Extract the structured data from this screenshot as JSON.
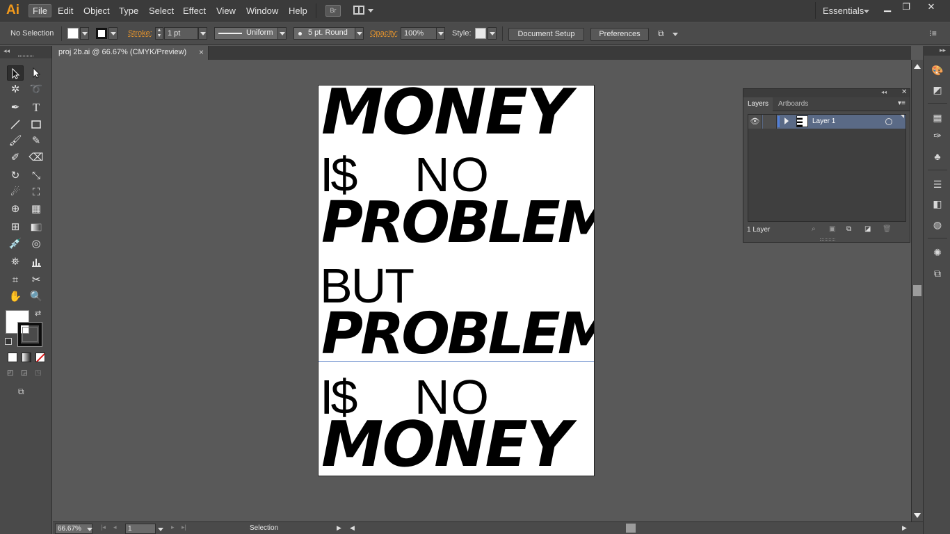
{
  "app": {
    "logo": "Ai",
    "menu": [
      "File",
      "Edit",
      "Object",
      "Type",
      "Select",
      "Effect",
      "View",
      "Window",
      "Help"
    ],
    "bridge_label": "Br",
    "workspace": "Essentials"
  },
  "control": {
    "selection_status": "No Selection",
    "stroke_label": "Stroke:",
    "stroke_weight": "1 pt",
    "profile": "Uniform",
    "brush": "5 pt. Round",
    "opacity_label": "Opacity:",
    "opacity_value": "100%",
    "style_label": "Style:",
    "document_setup": "Document Setup",
    "preferences": "Preferences"
  },
  "document": {
    "tab_title": "proj 2b.ai @ 66.67% (CMYK/Preview)",
    "close_glyph": "×"
  },
  "artwork": {
    "line1": "MONEY",
    "line2a": "I$",
    "line2b": "NO",
    "line3": "PROBLEM",
    "line4": "BUT",
    "line5": "PROBLEM",
    "line6a": "I$",
    "line6b": "NO",
    "line7": "MONEY"
  },
  "status": {
    "zoom": "66.67%",
    "page": "1",
    "tool": "Selection"
  },
  "layers_panel": {
    "tabs": [
      "Layers",
      "Artboards"
    ],
    "layers": [
      {
        "name": "Layer 1"
      }
    ],
    "count_label": "1 Layer"
  },
  "colors": {
    "accent_orange": "#f39a1b",
    "layer_highlight": "#5a6a86",
    "guide": "#5b82c7"
  }
}
